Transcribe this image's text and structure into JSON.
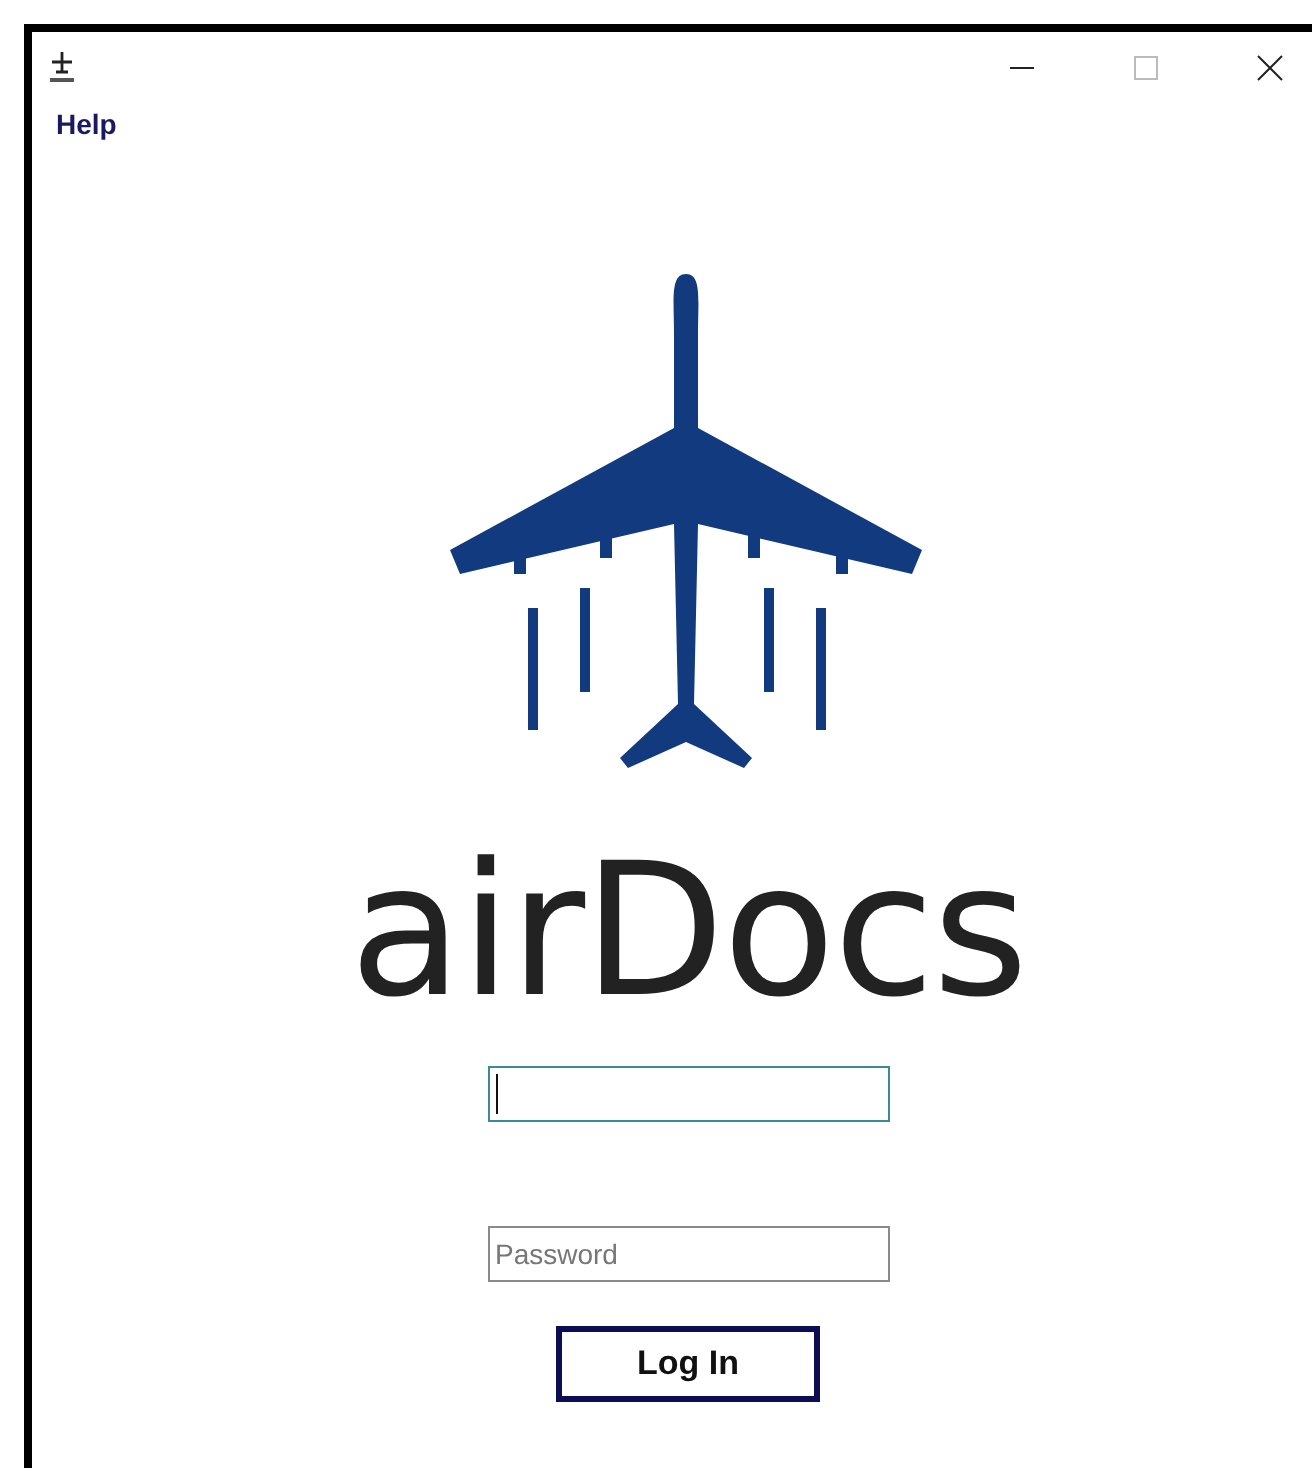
{
  "menu": [
    {
      "label": "Help"
    }
  ],
  "logo": {
    "text": "airDocs"
  },
  "username_field": {
    "focused": true
  },
  "password_field": {
    "placeholder": "Password",
    "focused": false
  },
  "login_button": {
    "label": "Log In"
  }
}
